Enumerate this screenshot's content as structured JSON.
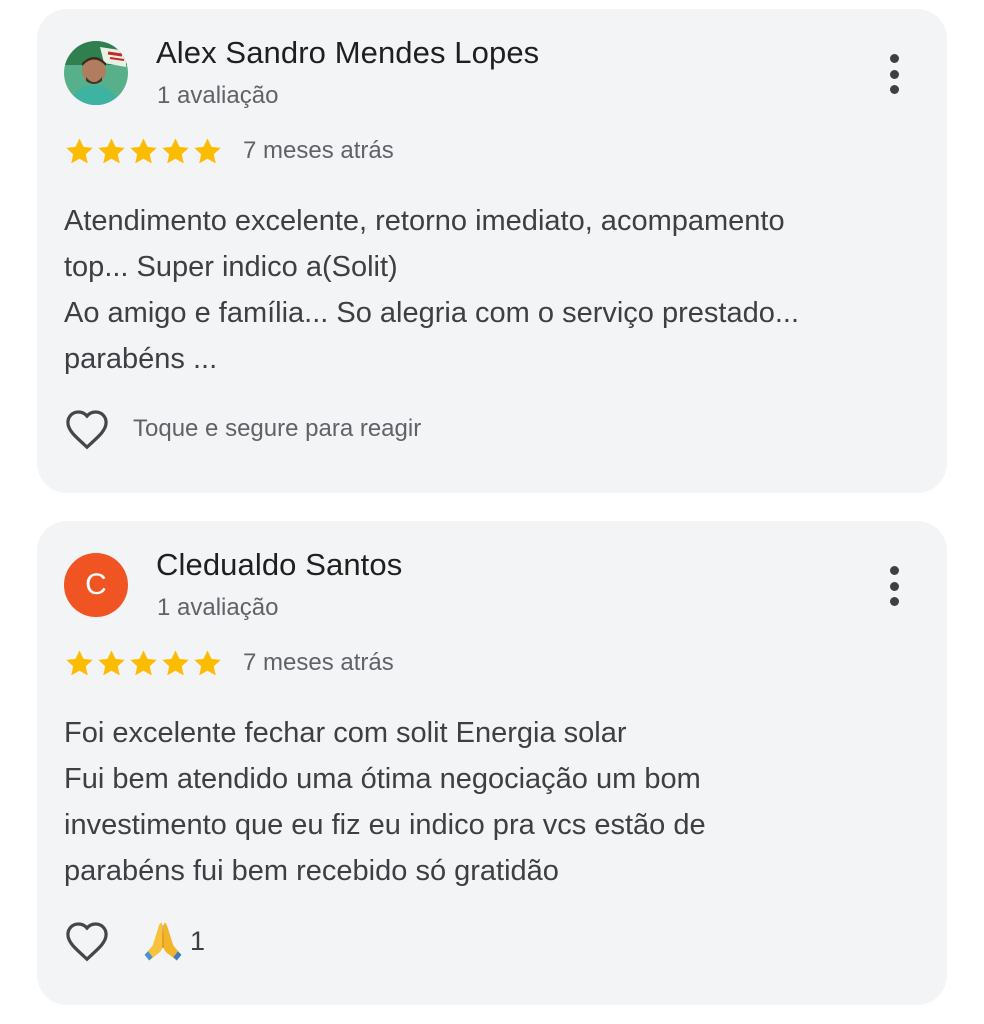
{
  "colors": {
    "card_bg": "#f3f4f6",
    "star": "#fbbc04",
    "avatar_letter_bg": "#f05422",
    "text_primary": "#1f1f1f",
    "text_secondary": "#5f6368"
  },
  "reviews": [
    {
      "author": "Alex Sandro Mendes Lopes",
      "review_count": "1 avaliação",
      "avatar_type": "photo",
      "rating": 5,
      "time": "7 meses atrás",
      "text_lines": [
        "Atendimento excelente, retorno imediato, acompamento",
        "top... Super indico a(Solit)",
        "Ao amigo e família... So alegria com o serviço prestado...",
        "parabéns ..."
      ],
      "react_hint": "Toque e segure para reagir",
      "menu_icon": "more-vert-icon",
      "heart_icon": "heart-outline-icon"
    },
    {
      "author": "Cledualdo Santos",
      "review_count": "1 avaliação",
      "avatar_type": "letter",
      "avatar_letter": "C",
      "rating": 5,
      "time": "7 meses atrás",
      "text_lines": [
        "Foi excelente fechar com solit Energia solar",
        "Fui bem atendido uma ótima negociação um bom",
        "investimento que eu fiz eu indico pra vcs estão de",
        "parabéns fui bem recebido só gratidão"
      ],
      "reaction_emoji": "folded-hands-emoji",
      "reaction_count": "1",
      "menu_icon": "more-vert-icon",
      "heart_icon": "heart-outline-icon"
    }
  ]
}
